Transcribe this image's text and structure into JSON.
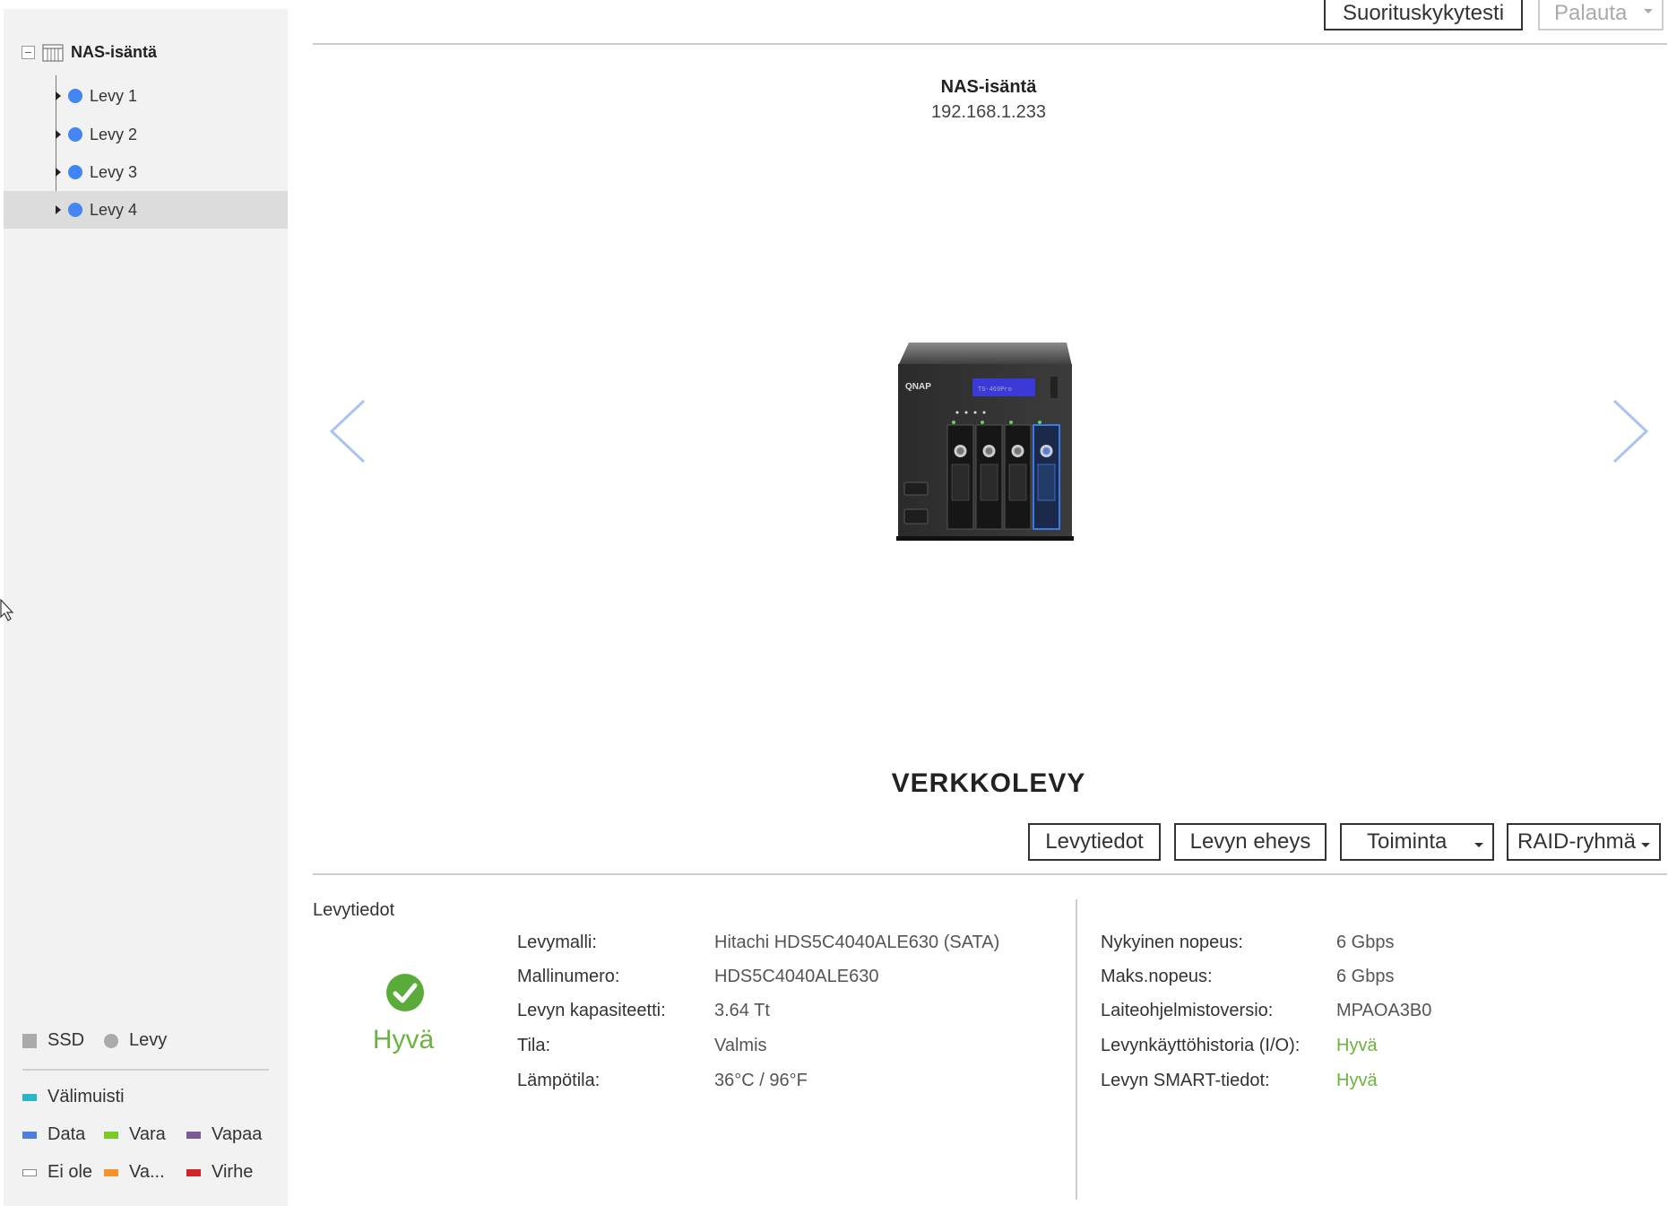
{
  "sidebar": {
    "root_label": "NAS-isäntä",
    "items": [
      {
        "label": "Levy 1"
      },
      {
        "label": "Levy 2"
      },
      {
        "label": "Levy 3"
      },
      {
        "label": "Levy 4",
        "selected": true
      }
    ],
    "legend": {
      "type_ssd": "SSD",
      "type_disk": "Levy",
      "cache": "Välimuisti",
      "data": "Data",
      "spare": "Vara",
      "free": "Vapaa",
      "none": "Ei ole",
      "va": "Va...",
      "error": "Virhe",
      "colors": {
        "ssd": "#aaaaaa",
        "disk": "#aaaaaa",
        "cache": "#29b6c9",
        "data": "#4a7fe0",
        "spare": "#7ec82a",
        "free": "#7b5b93",
        "none": "#ffffff",
        "va": "#f5922a",
        "error": "#d0242a"
      }
    }
  },
  "toolbar": {
    "performance_test": "Suorituskykytesti",
    "restore": "Palauta"
  },
  "device": {
    "name": "NAS-isäntä",
    "ip": "192.168.1.233",
    "brand": "QNAP",
    "lcd_text": "TS-469Pro",
    "type_title": "VERKKOLEVY"
  },
  "actions": {
    "disk_info": "Levytiedot",
    "disk_health": "Levyn eheys",
    "action": "Toiminta",
    "raid_group": "RAID-ryhmä"
  },
  "info": {
    "section_title": "Levytiedot",
    "status": "Hyvä",
    "left": [
      {
        "label": "Levymalli:",
        "value": "Hitachi HDS5C4040ALE630 (SATA)"
      },
      {
        "label": "Mallinumero:",
        "value": "HDS5C4040ALE630"
      },
      {
        "label": "Levyn kapasiteetti:",
        "value": "3.64 Tt"
      },
      {
        "label": "Tila:",
        "value": "Valmis"
      },
      {
        "label": "Lämpötila:",
        "value": "36°C / 96°F"
      }
    ],
    "right": [
      {
        "label": "Nykyinen nopeus:",
        "value": "6 Gbps"
      },
      {
        "label": "Maks.nopeus:",
        "value": "6 Gbps"
      },
      {
        "label": "Laiteohjelmistoversio:",
        "value": "MPAOA3B0"
      },
      {
        "label": "Levynkäyttöhistoria (I/O):",
        "value": "Hyvä"
      },
      {
        "label": "Levyn SMART-tiedot:",
        "value": "Hyvä"
      }
    ],
    "good_color": "#6cb33f"
  }
}
